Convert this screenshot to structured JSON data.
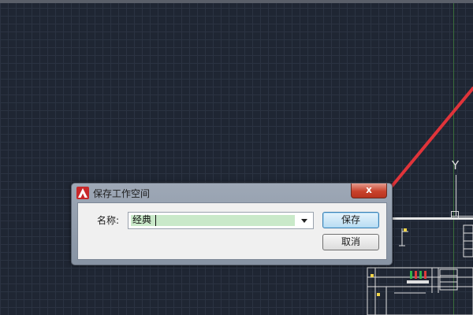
{
  "dialog": {
    "title": "保存工作空间",
    "close_label": "x",
    "name_label": "名称:",
    "name_value": "经典",
    "save_label": "保存",
    "cancel_label": "取消"
  },
  "canvas": {
    "ucs_axis_label": "Y"
  },
  "colors": {
    "canvas_bg": "#1f2633",
    "arrow": "#e0343a",
    "close_button": "#c8422c",
    "selection": "#c9e9c9"
  },
  "icons": {
    "app": "autocad-logo-icon",
    "dropdown": "chevron-down-icon"
  }
}
